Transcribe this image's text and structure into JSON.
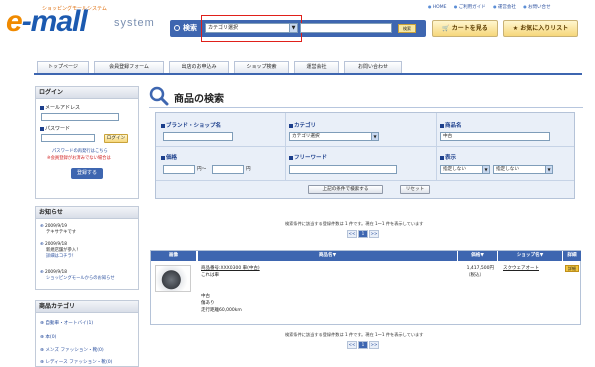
{
  "header": {
    "logo_tagline": "ショッピングモールシステム",
    "logo_main_e": "e",
    "logo_main_rest": "-mall",
    "logo_system": "system",
    "search_label": "検索",
    "category_selected": "カテゴリ選択",
    "search_button": "検索",
    "cart_button": "カートを見る",
    "favorites_button": "お気に入りリスト",
    "top_links": [
      "HOME",
      "ご利用ガイド",
      "運営会社",
      "お問い合せ"
    ]
  },
  "nav": {
    "tabs": [
      "トップページ",
      "会員登録フォーム",
      "出店のお申込み",
      "ショップ検索",
      "運営会社",
      "お問い合わせ"
    ]
  },
  "login": {
    "title": "ログイン",
    "email_label": "メールアドレス",
    "password_label": "パスワード",
    "login_button": "ログイン",
    "forgot_link": "パスワードの再発行はこちら",
    "notice": "※会員登録がお済みでない場合は",
    "register_button": "登録する"
  },
  "news": {
    "title": "お知らせ",
    "items": [
      {
        "date": "2009/9/19",
        "text": "テキサテキです"
      },
      {
        "date": "2009/9/18",
        "text": "新規店舗が参入！",
        "link": "詳細はコチラ！"
      },
      {
        "date": "2009/9/18",
        "text": "ショッピングモールからのお知らせ"
      }
    ]
  },
  "categories": {
    "title": "商品カテゴリ",
    "items": [
      "自動車・オートバイ(1)",
      "本(0)",
      "メンズ ファッション・靴(0)",
      "レディース ファッション・靴(0)"
    ]
  },
  "search_page": {
    "title": "商品の検索",
    "brand_label": "ブランド・ショップ名",
    "category_label": "カテゴリ",
    "category_value": "カテゴリ選択",
    "product_label": "商品名",
    "product_value": "中古",
    "price_label": "価格",
    "price_from_suffix": "円〜",
    "price_to_suffix": "円",
    "freeword_label": "フリーワード",
    "display_label": "表示",
    "display_option1": "指定しない",
    "display_option2": "指定しない",
    "search_button": "上記の条件で検索する",
    "reset_button": "リセット"
  },
  "results": {
    "summary": "検索条件に該当する登録件数は 1 件です。現在 1〜1 件を表示しています",
    "pager": [
      "<<",
      "1",
      ">>"
    ],
    "columns": [
      "画像",
      "商品名▼",
      "価格▼",
      "ショップ名▼",
      "詳細"
    ],
    "row": {
      "name_link": "商品番号:XXX0300 車(中古)",
      "desc1": "これは車",
      "desc2": "中古",
      "desc3": "傷あり",
      "desc4": "走行距離60,000km",
      "price": "1,417,500円",
      "tax": "（税込）",
      "shop": "スクウェアオート",
      "detail": "詳細"
    }
  },
  "colors": {
    "brand_blue": "#3e66b0",
    "logo_orange": "#f08a00",
    "highlight_red": "#e0201a"
  }
}
